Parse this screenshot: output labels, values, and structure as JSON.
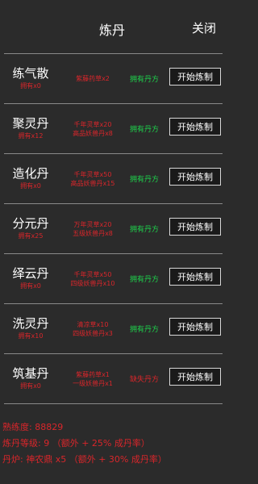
{
  "header": {
    "title": "炼丹",
    "close_label": "关闭"
  },
  "pills": [
    {
      "name": "练气散",
      "owned": "拥有x0",
      "materials": [
        "紫藤药草x2"
      ],
      "recipe": "拥有丹方",
      "recipe_owned": true,
      "button": "开始炼制"
    },
    {
      "name": "聚灵丹",
      "owned": "拥有x12",
      "materials": [
        "千年灵草x20",
        "高品妖兽丹x8"
      ],
      "recipe": "拥有丹方",
      "recipe_owned": true,
      "button": "开始炼制"
    },
    {
      "name": "造化丹",
      "owned": "拥有x0",
      "materials": [
        "千年灵草x50",
        "高品妖兽丹x15"
      ],
      "recipe": "拥有丹方",
      "recipe_owned": true,
      "button": "开始炼制"
    },
    {
      "name": "分元丹",
      "owned": "拥有x25",
      "materials": [
        "万年灵草x20",
        "五级妖兽丹x8"
      ],
      "recipe": "拥有丹方",
      "recipe_owned": true,
      "button": "开始炼制"
    },
    {
      "name": "绎云丹",
      "owned": "拥有x0",
      "materials": [
        "千年灵草x50",
        "四级妖兽丹x10"
      ],
      "recipe": "拥有丹方",
      "recipe_owned": true,
      "button": "开始炼制"
    },
    {
      "name": "洗灵丹",
      "owned": "拥有x10",
      "materials": [
        "清凉草x10",
        "四级妖兽丹x3"
      ],
      "recipe": "拥有丹方",
      "recipe_owned": true,
      "button": "开始炼制"
    },
    {
      "name": "筑基丹",
      "owned": "拥有x0",
      "materials": [
        "紫藤药草x1",
        "一级妖兽丹x1"
      ],
      "recipe": "缺失丹方",
      "recipe_owned": false,
      "button": "开始炼制"
    }
  ],
  "footer": {
    "proficiency": "熟练度:  88829",
    "level": "炼丹等级:  9  （额外 + 25% 成丹率）",
    "furnace": "丹炉:  神农鼎 x5  （额外 + 30% 成丹率）"
  },
  "colors": {
    "background": "#2b2b2b",
    "warning": "#d9262b",
    "success": "#1ed14b"
  }
}
